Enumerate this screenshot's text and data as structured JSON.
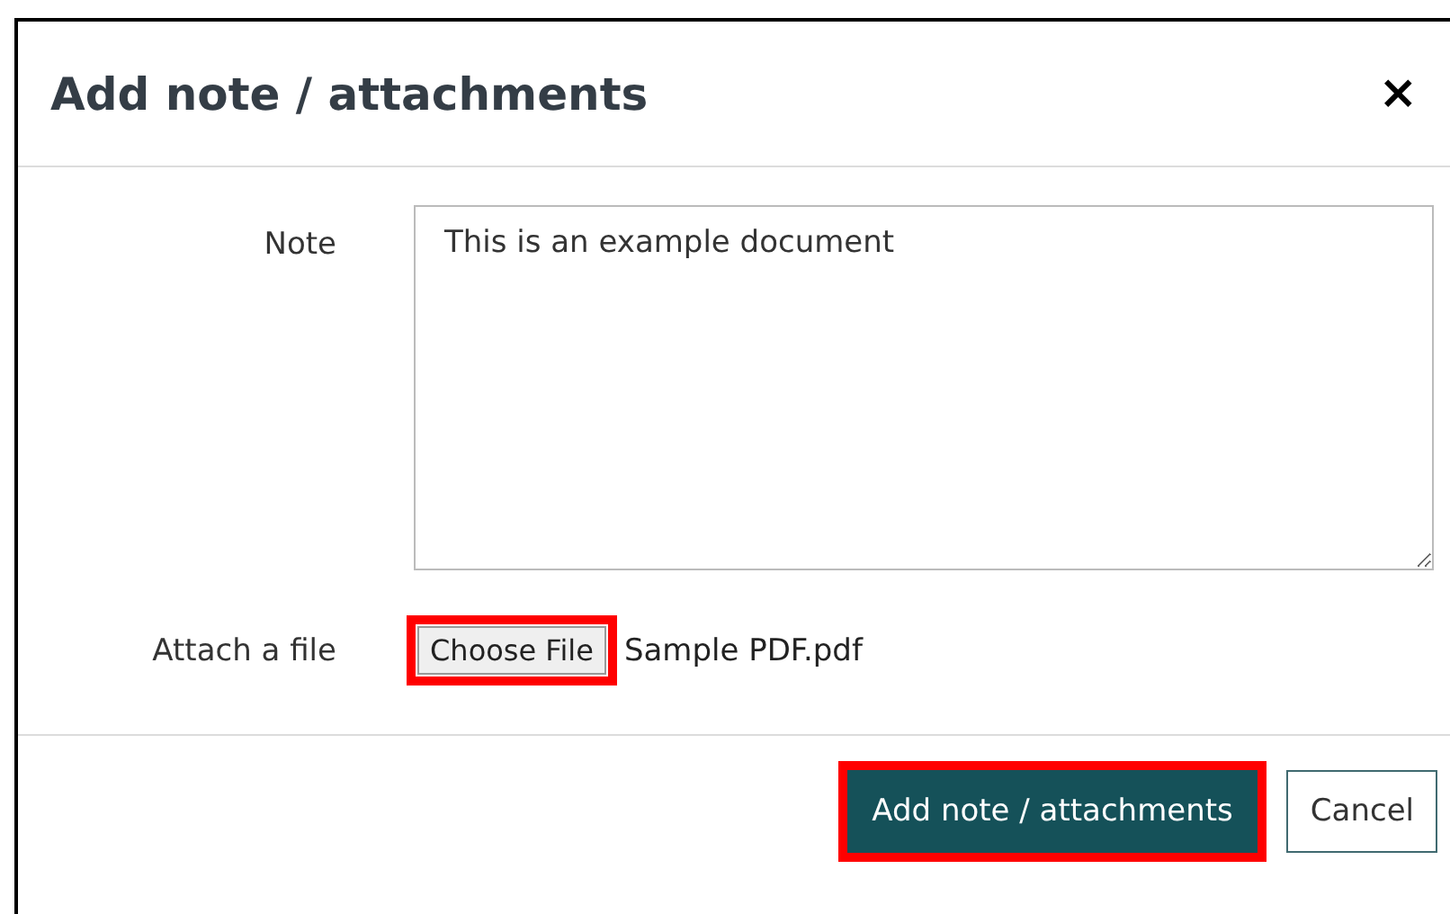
{
  "dialog": {
    "title": "Add note / attachments",
    "close": "×"
  },
  "fields": [
    {
      "kind": "textarea",
      "label": "Note",
      "value": "This is an example document"
    },
    {
      "kind": "file",
      "label": "Attach a file",
      "button": "Choose File",
      "highlighted": true,
      "file_name": "Sample PDF.pdf"
    }
  ],
  "buttons": [
    {
      "label": "Add note / attachments",
      "kind": "primary",
      "highlighted": true
    },
    {
      "label": "Cancel",
      "kind": "secondary",
      "highlighted": false
    }
  ]
}
